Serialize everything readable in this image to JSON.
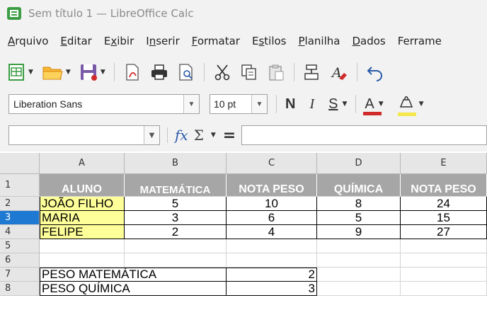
{
  "window": {
    "title": "Sem título 1 — LibreOffice Calc"
  },
  "menu": [
    {
      "pre": "",
      "u": "A",
      "post": "rquivo"
    },
    {
      "pre": "",
      "u": "E",
      "post": "ditar"
    },
    {
      "pre": "E",
      "u": "x",
      "post": "ibir"
    },
    {
      "pre": "I",
      "u": "n",
      "post": "serir"
    },
    {
      "pre": "",
      "u": "F",
      "post": "ormatar"
    },
    {
      "pre": "E",
      "u": "s",
      "post": "tilos"
    },
    {
      "pre": "",
      "u": "P",
      "post": "lanilha"
    },
    {
      "pre": "",
      "u": "D",
      "post": "ados"
    },
    {
      "pre": "",
      "u": "",
      "post": "Ferrame"
    }
  ],
  "format": {
    "font_name": "Liberation Sans",
    "font_size": "10 pt",
    "bold": "N",
    "italic": "I",
    "underline": "S",
    "font_color_glyph": "A"
  },
  "formula": {
    "fx": "fx",
    "sigma": "Σ",
    "equals": "="
  },
  "grid": {
    "columns": [
      "A",
      "B",
      "C",
      "D",
      "E"
    ],
    "rows": [
      "1",
      "2",
      "3",
      "4",
      "5",
      "6",
      "7",
      "8"
    ],
    "selected_row": "3",
    "headers": [
      "ALUNO",
      "MATEMÁTICA",
      "NOTA PESO",
      "QUÍMICA",
      "NOTA PESO"
    ],
    "data": [
      [
        "JOÃO FILHO",
        "5",
        "10",
        "8",
        "24"
      ],
      [
        "MARIA",
        "3",
        "6",
        "5",
        "15"
      ],
      [
        "FELIPE",
        "2",
        "4",
        "9",
        "27"
      ]
    ],
    "weights": [
      {
        "label": "PESO MATEMÁTICA",
        "value": "2"
      },
      {
        "label": "PESO QUÍMICA",
        "value": "3"
      }
    ]
  },
  "colors": {
    "header_fill": "#a6a6a6",
    "name_fill": "#ffff99",
    "selected_row": "#1e79d2",
    "app_green": "#3b9c43"
  }
}
